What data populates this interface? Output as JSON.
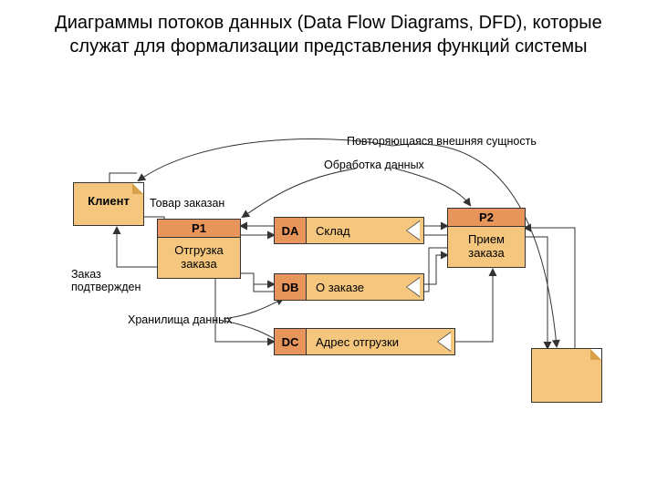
{
  "title": "Диаграммы потоков данных (Data Flow Diagrams, DFD), которые служат для формализации представления функций системы",
  "entities": {
    "client": "Клиент"
  },
  "processes": {
    "p1": {
      "id": "P1",
      "name": "Отгрузка заказа"
    },
    "p2": {
      "id": "P2",
      "name": "Прием заказа"
    }
  },
  "stores": {
    "da": {
      "id": "DA",
      "name": "Склад"
    },
    "db": {
      "id": "DB",
      "name": "О заказе"
    },
    "dc": {
      "id": "DC",
      "name": "Адрес отгрузки"
    }
  },
  "flows": {
    "goods_ordered": "Товар заказан",
    "order_confirmed": "Заказ подтвержден"
  },
  "annotations": {
    "repeating_entity": "Повторяющаяся внешняя сущность",
    "data_processing": "Обработка данных",
    "data_stores": "Хранилища данных"
  }
}
